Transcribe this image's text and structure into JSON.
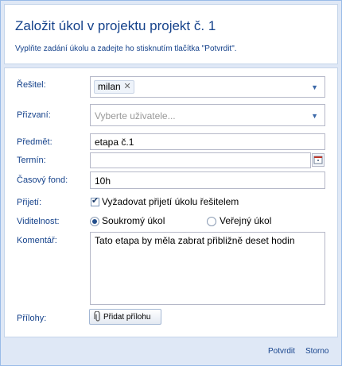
{
  "dialog": {
    "title": "Založit úkol v projektu projekt č. 1",
    "subtitle": "Vyplňte zadání úkolu a zadejte ho stisknutím tlačítka \"Potvrdit\"."
  },
  "form": {
    "resitel_label": "Řešitel:",
    "resitel_tag": "milan",
    "prizvani_label": "Přizvaní:",
    "prizvani_placeholder": "Vyberte uživatele...",
    "predmet_label": "Předmět:",
    "predmet_value": "etapa č.1",
    "termin_label": "Termín:",
    "termin_value": "",
    "casovy_fond_label": "Časový fond:",
    "casovy_fond_value": "10h",
    "prijeti_label": "Přijetí:",
    "prijeti_checkbox_label": "Vyžadovat přijetí úkolu řešitelem",
    "prijeti_checked": true,
    "viditelnost_label": "Viditelnost:",
    "viditelnost_options": [
      "Soukromý úkol",
      "Veřejný úkol"
    ],
    "viditelnost_selected": "Soukromý úkol",
    "komentar_label": "Komentář:",
    "komentar_value": "Tato etapa by měla zabrat přibližně deset hodin",
    "prilohy_label": "Přílohy:",
    "add_attachment_label": "Přidat přílohu"
  },
  "footer": {
    "confirm_label": "Potvrdit",
    "cancel_label": "Storno"
  },
  "icons": {
    "remove_tag": "close-icon",
    "dropdown": "chevron-down-icon",
    "calendar": "calendar-icon",
    "attachment": "paperclip-icon"
  },
  "colors": {
    "header_text": "#15428b",
    "frame_background": "#dfe8f6",
    "border": "#99bbe8"
  }
}
